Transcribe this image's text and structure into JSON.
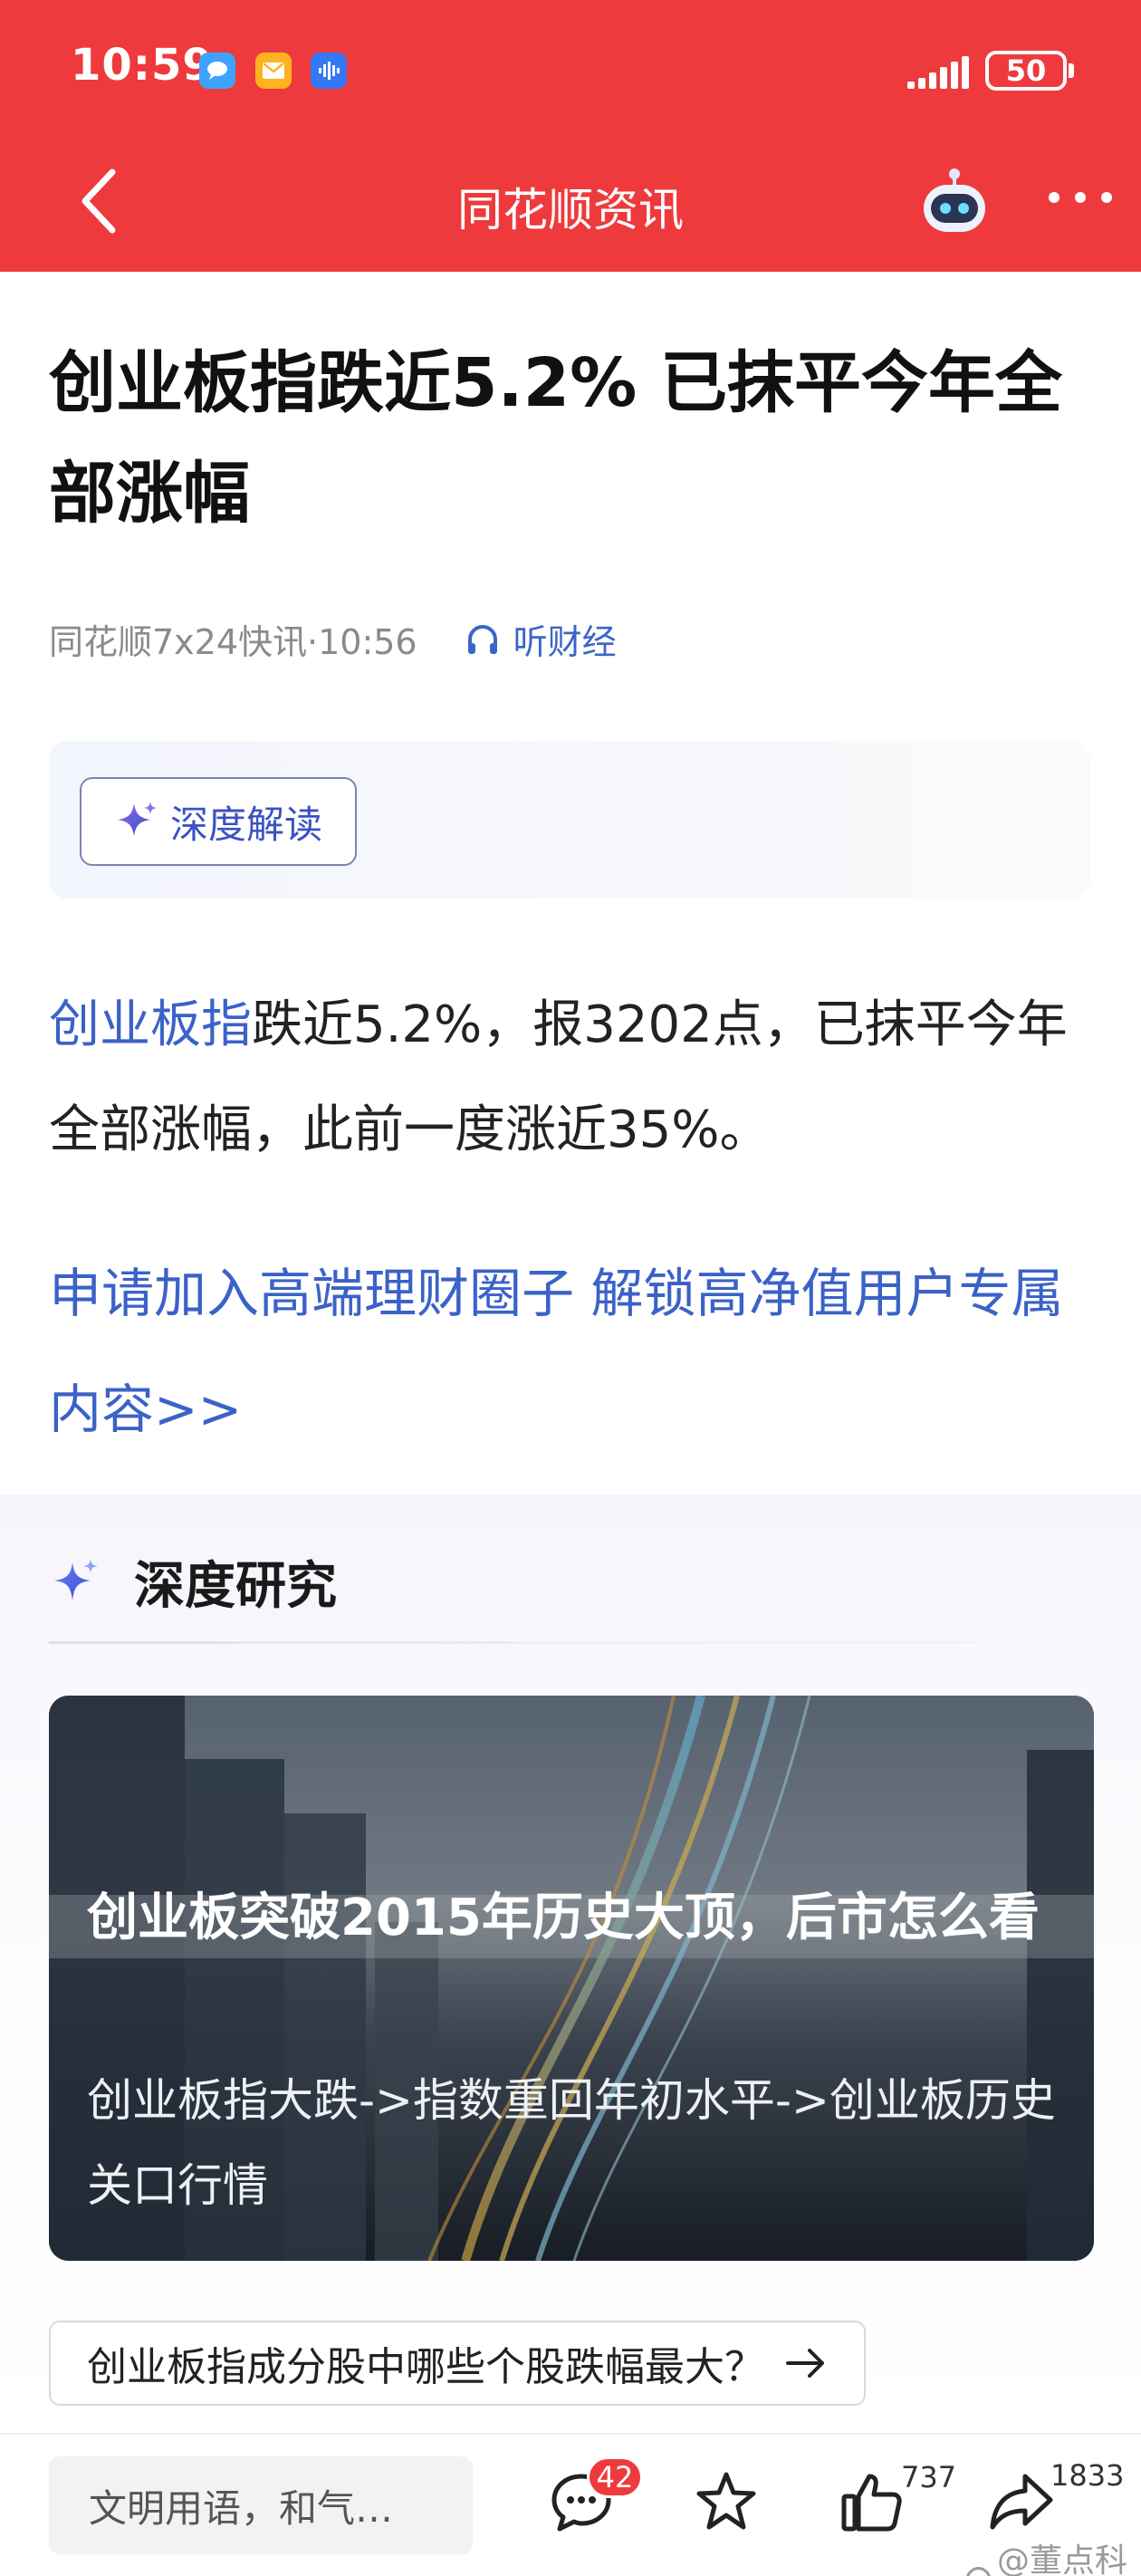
{
  "status_bar": {
    "time": "10:59",
    "battery": "50",
    "apps": [
      "chat-icon",
      "mail-icon",
      "voice-icon"
    ]
  },
  "nav": {
    "title": "同花顺资讯"
  },
  "article": {
    "headline": "创业板指跌近5.2% 已抹平今年全部涨幅",
    "source_time": "同花顺7x24快讯·10:56",
    "listen_label": "听财经",
    "ai_button_label": "深度解读",
    "body_highlight": "创业板指",
    "body_rest": "跌近5.2%，报3202点，已抹平今年全部涨幅，此前一度涨近35%。",
    "promo_text": "申请加入高端理财圈子 解锁高净值用户专属内容>>"
  },
  "research": {
    "section_title": "深度研究",
    "card_title": "创业板突破2015年历史大顶，后市怎么看",
    "card_subtitle": "创业板指大跌->指数重回年初水平->创业板历史关口行情",
    "question": "创业板指成分股中哪些个股跌幅最大？"
  },
  "bottom_bar": {
    "comment_placeholder": "文明用语，和气…",
    "comment_count": "42",
    "like_count": "737",
    "share_count": "1833",
    "watermark": "@董点科技"
  },
  "colors": {
    "header_red": "#ee3a3d",
    "link_blue": "#3b62c8"
  }
}
